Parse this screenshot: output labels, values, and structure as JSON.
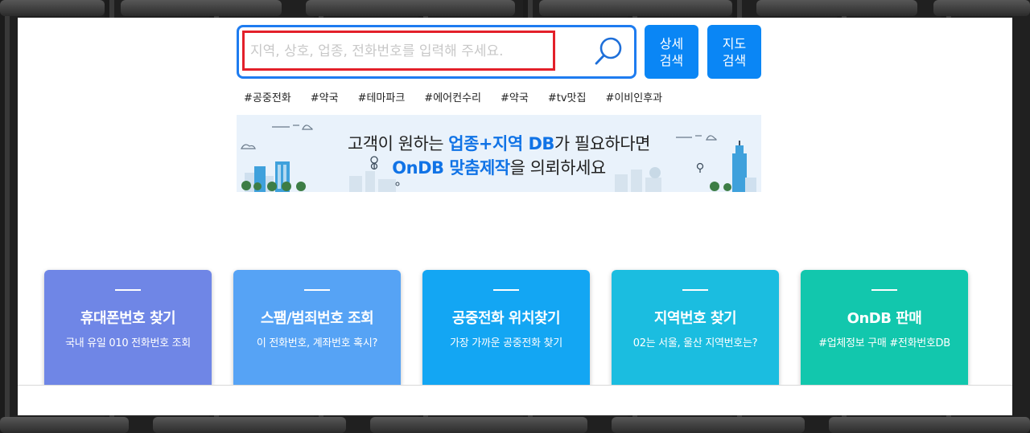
{
  "search": {
    "placeholder": "지역, 상호, 업종, 전화번호를 입력해 주세요.",
    "value": ""
  },
  "buttons": {
    "detail_line1": "상세",
    "detail_line2": "검색",
    "map_line1": "지도",
    "map_line2": "검색"
  },
  "hashtags": [
    "#공중전화",
    "#약국",
    "#테마파크",
    "#에어컨수리",
    "#약국",
    "#tv맛집",
    "#이비인후과"
  ],
  "banner": {
    "line1_pre": "고객이 원하는 ",
    "line1_highlight": "업종+지역 DB",
    "line1_post": "가 필요하다면",
    "line2_highlight": "OnDB 맞춤제작",
    "line2_post": "을 의뢰하세요"
  },
  "cards": [
    {
      "title": "휴대폰번호 찾기",
      "subtitle": "국내 유일 010 전화번호 조회"
    },
    {
      "title": "스팸/범죄번호 조회",
      "subtitle": "이 전화번호, 계좌번호 혹시?"
    },
    {
      "title": "공중전화 위치찾기",
      "subtitle": "가장 가까운 공중전화 찾기"
    },
    {
      "title": "지역번호 찾기",
      "subtitle": "02는 서울, 울산 지역번호는?"
    },
    {
      "title": "OnDB 판매",
      "subtitle": "#업체정보 구매 #전화번호DB"
    }
  ],
  "colors": {
    "accent": "#0a86f5",
    "highlight_border": "#e3202a",
    "card1": "#6f86e6",
    "card2": "#56a3f5",
    "card3": "#13a6f3",
    "card4": "#1bbde0",
    "card5": "#12c7ad"
  }
}
